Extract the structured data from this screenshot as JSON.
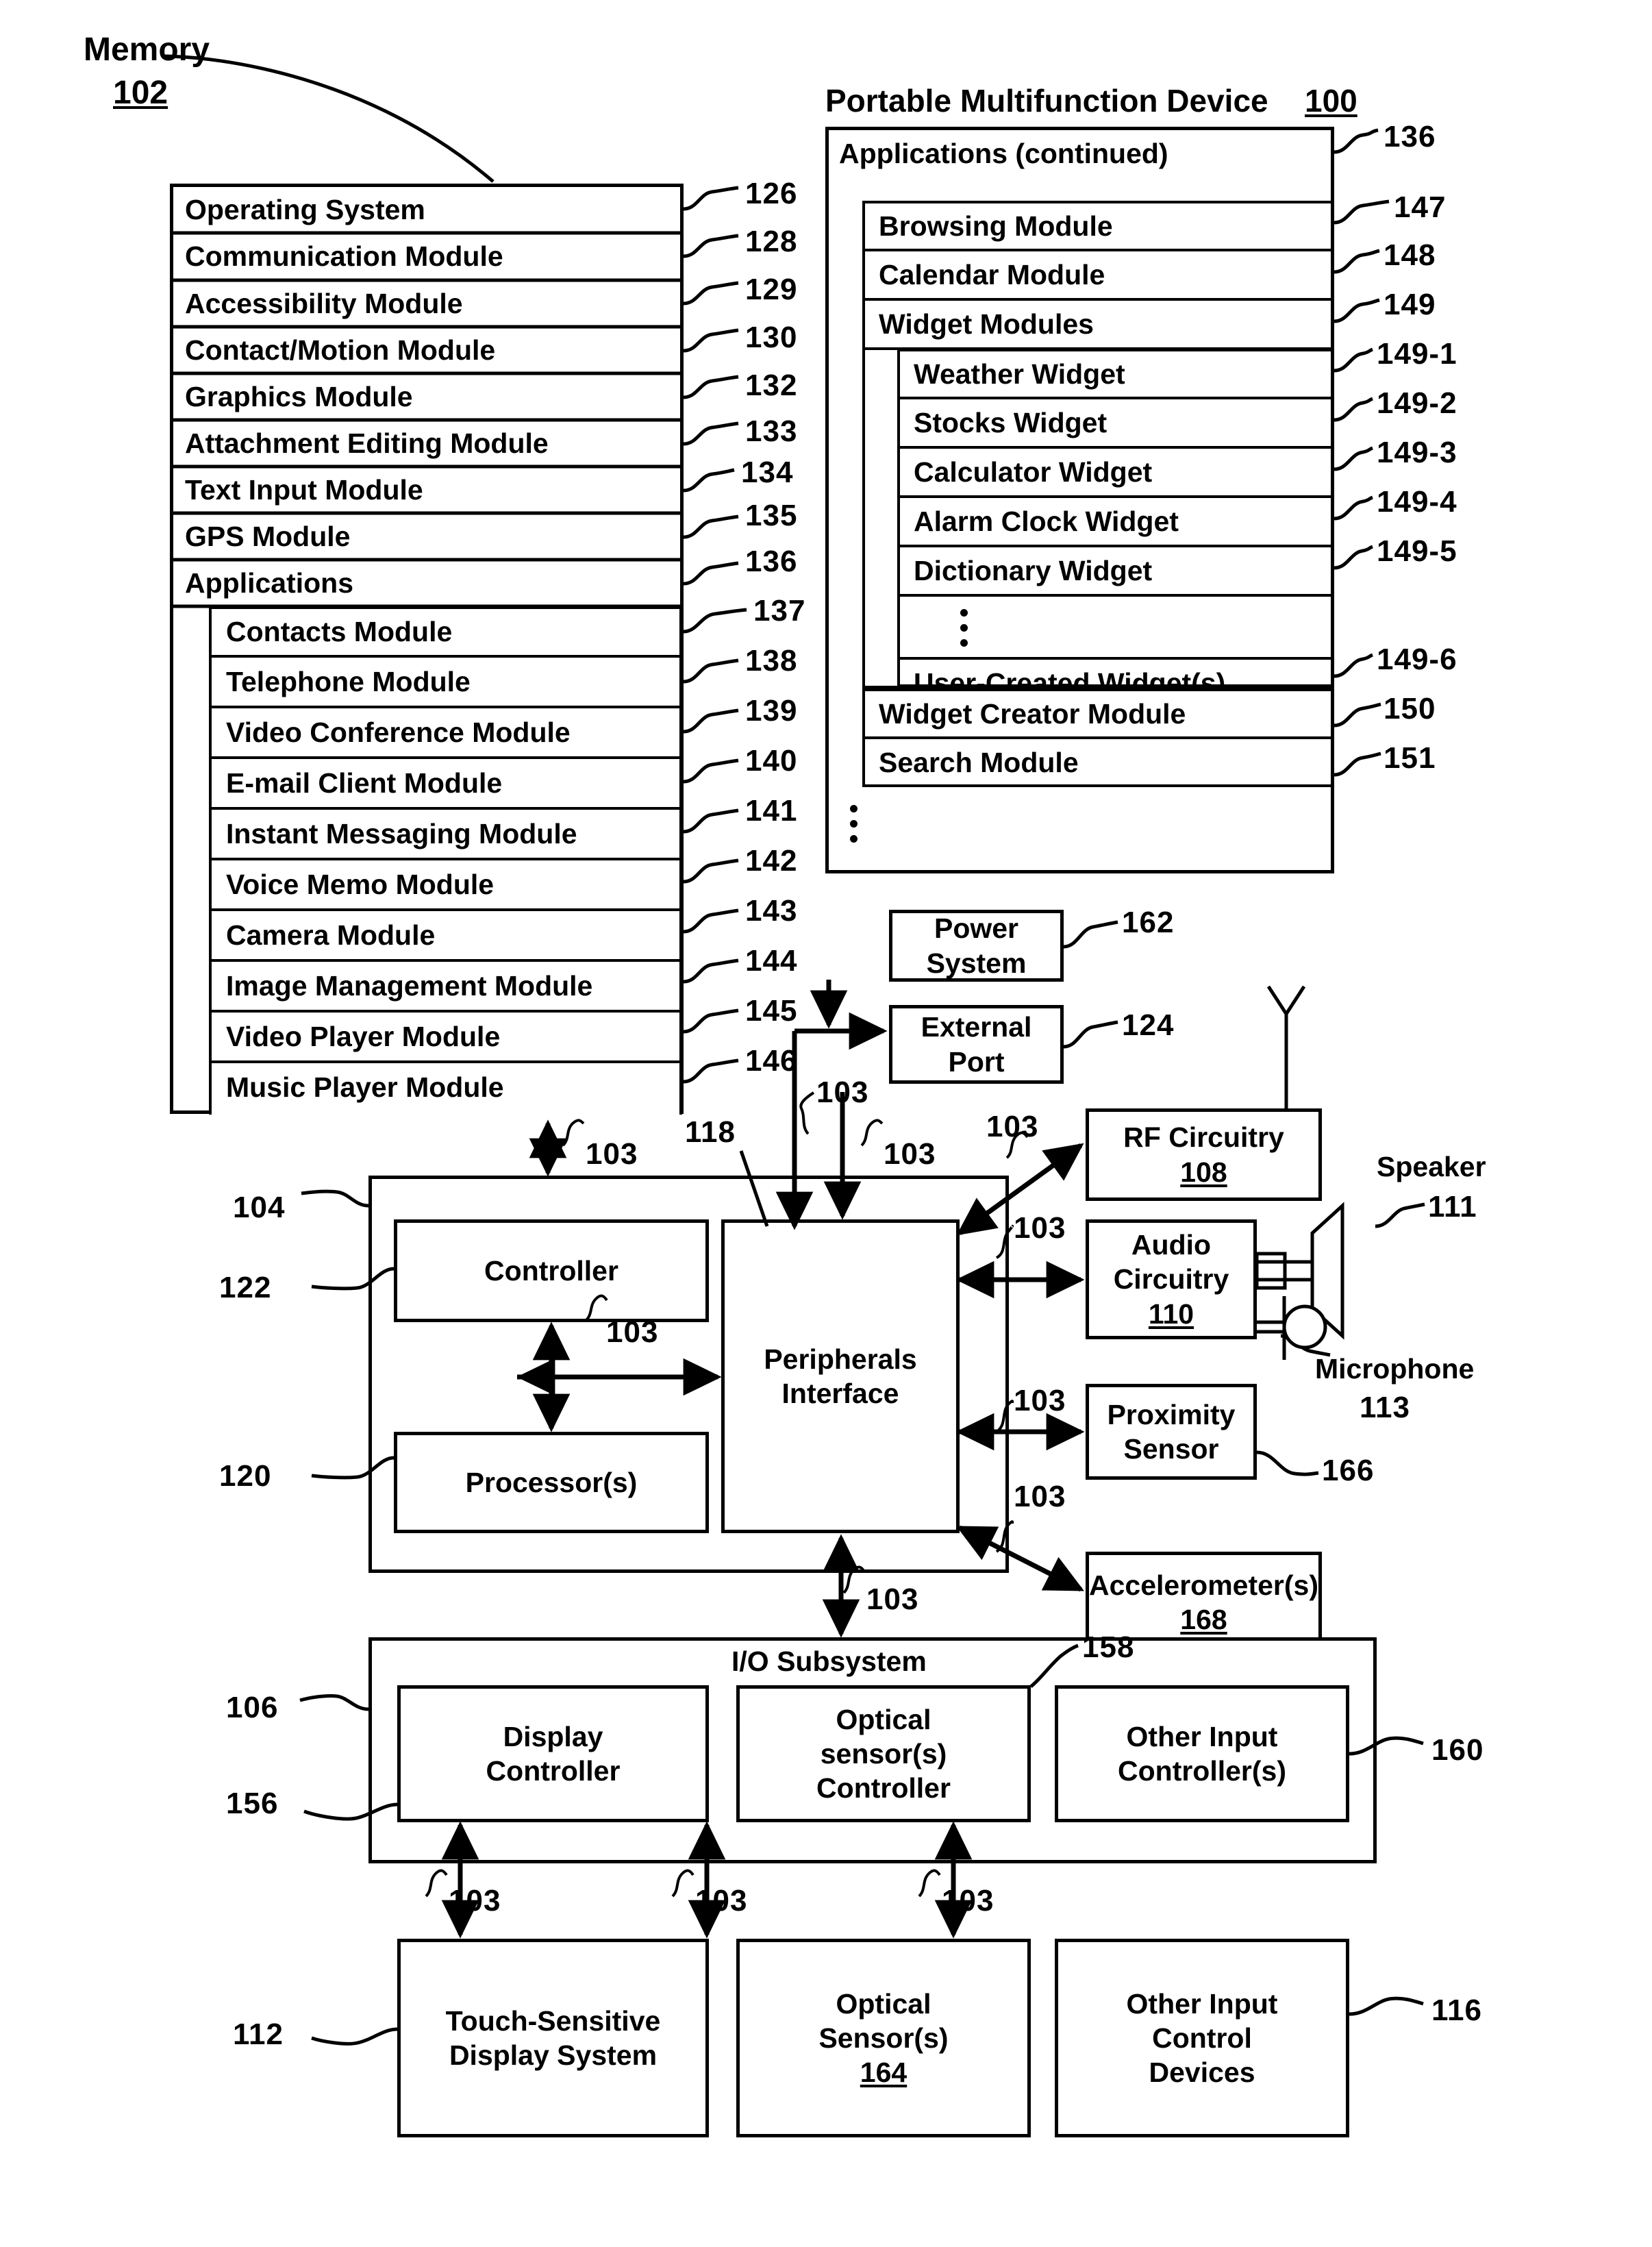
{
  "figure": {
    "memory_label": "Memory",
    "memory_ref": "102",
    "device_label": "Portable Multifunction Device",
    "device_ref": "100"
  },
  "memory_box": {
    "items": [
      {
        "label": "Operating System",
        "ref": "126"
      },
      {
        "label": "Communication Module",
        "ref": "128"
      },
      {
        "label": "Accessibility Module",
        "ref": "129"
      },
      {
        "label": "Contact/Motion Module",
        "ref": "130"
      },
      {
        "label": "Graphics Module",
        "ref": "132"
      },
      {
        "label": "Attachment Editing Module",
        "ref": "133"
      },
      {
        "label": "Text Input Module",
        "ref": "134"
      },
      {
        "label": "GPS Module",
        "ref": "135"
      },
      {
        "label": "Applications",
        "ref": "136"
      }
    ],
    "applications": [
      {
        "label": "Contacts Module",
        "ref": "137"
      },
      {
        "label": "Telephone Module",
        "ref": "138"
      },
      {
        "label": "Video Conference Module",
        "ref": "139"
      },
      {
        "label": "E-mail Client Module",
        "ref": "140"
      },
      {
        "label": "Instant Messaging Module",
        "ref": "141"
      },
      {
        "label": "Voice Memo Module",
        "ref": "142"
      },
      {
        "label": "Camera Module",
        "ref": "143"
      },
      {
        "label": "Image Management Module",
        "ref": "144"
      },
      {
        "label": "Video Player Module",
        "ref": "145"
      },
      {
        "label": "Music Player Module",
        "ref": "146"
      }
    ]
  },
  "applications_continued_box": {
    "header": "Applications (continued)",
    "header_ref": "136",
    "items": [
      {
        "label": "Browsing Module",
        "ref": "147"
      },
      {
        "label": "Calendar Module",
        "ref": "148"
      },
      {
        "label": "Widget Modules",
        "ref": "149"
      }
    ],
    "widgets": [
      {
        "label": "Weather Widget",
        "ref": "149-1"
      },
      {
        "label": "Stocks Widget",
        "ref": "149-2"
      },
      {
        "label": "Calculator Widget",
        "ref": "149-3"
      },
      {
        "label": "Alarm Clock Widget",
        "ref": "149-4"
      },
      {
        "label": "Dictionary Widget",
        "ref": "149-5"
      },
      {
        "label": "User-Created Widget(s)",
        "ref": "149-6"
      }
    ],
    "trailing_items": [
      {
        "label": "Widget Creator Module",
        "ref": "150"
      },
      {
        "label": "Search Module",
        "ref": "151"
      }
    ]
  },
  "blocks": {
    "power_system": {
      "label": "Power\nSystem",
      "line1": "Power",
      "line2": "System",
      "ref": "162"
    },
    "external_port": {
      "line1": "External",
      "line2": "Port",
      "ref": "124"
    },
    "rf_circuitry": {
      "line1": "RF Circuitry",
      "ref": "108"
    },
    "audio_circuitry": {
      "line1": "Audio",
      "line2": "Circuitry",
      "ref": "110"
    },
    "proximity_sensor": {
      "line1": "Proximity",
      "line2": "Sensor",
      "ref": "166"
    },
    "accelerometers": {
      "line1": "Accelerometer(s)",
      "ref": "168"
    },
    "speaker": {
      "label": "Speaker",
      "ref": "111"
    },
    "microphone": {
      "label": "Microphone",
      "ref": "113"
    },
    "controller": {
      "label": "Controller",
      "ref": "122"
    },
    "processors": {
      "label": "Processor(s)",
      "ref": "120"
    },
    "peripherals_interface": {
      "line1": "Peripherals",
      "line2": "Interface",
      "ref": "118"
    },
    "cpu_group_ref": "104",
    "io_subsystem": {
      "label": "I/O Subsystem",
      "ref": "158",
      "outer_ref": "106"
    },
    "display_controller": {
      "line1": "Display",
      "line2": "Controller",
      "ref": "156"
    },
    "optical_sensor_controller": {
      "line1": "Optical",
      "line2": "sensor(s)",
      "line3": "Controller"
    },
    "other_input_controllers": {
      "line1": "Other Input",
      "line2": "Controller(s)",
      "ref": "160"
    },
    "touch_display": {
      "line1": "Touch-Sensitive",
      "line2": "Display System",
      "ref": "112"
    },
    "optical_sensors": {
      "line1": "Optical",
      "line2": "Sensor(s)",
      "ref": "164"
    },
    "other_input_devices": {
      "line1": "Other Input",
      "line2": "Control",
      "line3": "Devices",
      "ref": "116"
    }
  },
  "bus_label": "103",
  "bus_labels": [
    "103",
    "103",
    "103",
    "103",
    "103",
    "103",
    "103",
    "103",
    "103",
    "103",
    "103",
    "103",
    "103"
  ]
}
